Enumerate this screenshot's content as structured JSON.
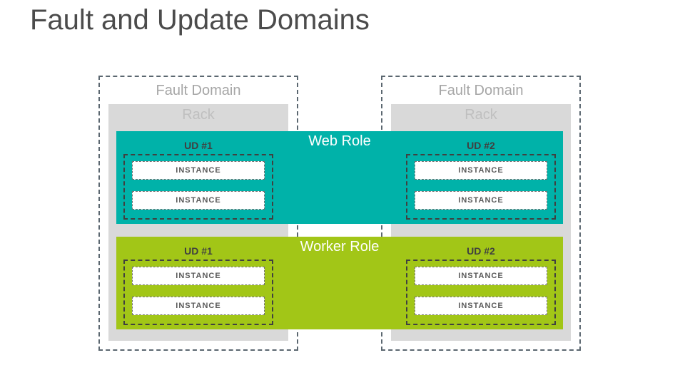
{
  "title": "Fault and Update Domains",
  "labels": {
    "fault_domain": "Fault Domain",
    "rack": "Rack",
    "web_role": "Web Role",
    "worker_role": "Worker Role",
    "ud1": "UD #1",
    "ud2": "UD #2",
    "instance": "INSTANCE"
  }
}
